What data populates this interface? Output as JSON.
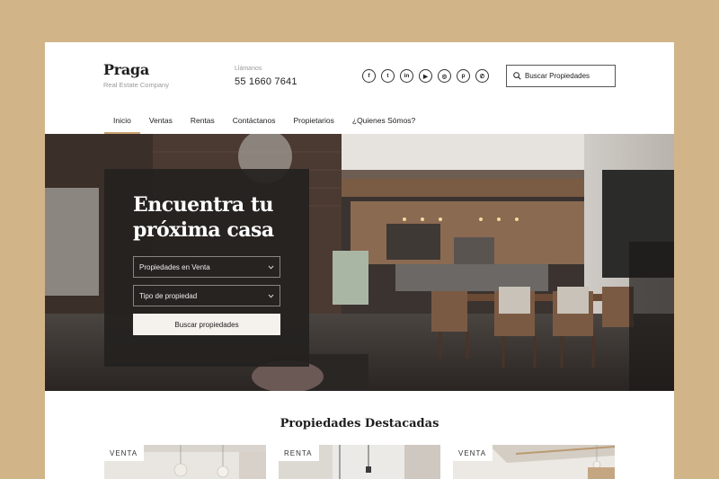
{
  "brand": {
    "name": "Praga",
    "tagline": "Real Estate Company"
  },
  "contact": {
    "label": "Llámanos",
    "phone": "55 1660 7641"
  },
  "social": [
    {
      "icon": "facebook-icon",
      "glyph": "f"
    },
    {
      "icon": "twitter-icon",
      "glyph": "t"
    },
    {
      "icon": "linkedin-icon",
      "glyph": "in"
    },
    {
      "icon": "youtube-icon",
      "glyph": "▶"
    },
    {
      "icon": "instagram-icon",
      "glyph": "◎"
    },
    {
      "icon": "pinterest-icon",
      "glyph": "p"
    },
    {
      "icon": "whatsapp-icon",
      "glyph": "✆"
    }
  ],
  "search": {
    "placeholder": "Buscar Propiedades"
  },
  "nav": {
    "items": [
      "Inicio",
      "Ventas",
      "Rentas",
      "Contáctanos",
      "Propietarios",
      "¿Quienes Sómos?"
    ],
    "active": "Inicio"
  },
  "hero": {
    "title_line1": "Encuentra tu",
    "title_line2": "próxima casa",
    "select_operation": "Propiedades en Venta",
    "select_type": "Tipo de propiedad",
    "button": "Buscar propiedades"
  },
  "featured": {
    "title": "Propiedades Destacadas",
    "cards": [
      {
        "badge": "VENTA"
      },
      {
        "badge": "RENTA"
      },
      {
        "badge": "VENTA"
      }
    ]
  },
  "colors": {
    "accent": "#c9a36e",
    "background": "#d2b489",
    "panel": "#23211f"
  }
}
